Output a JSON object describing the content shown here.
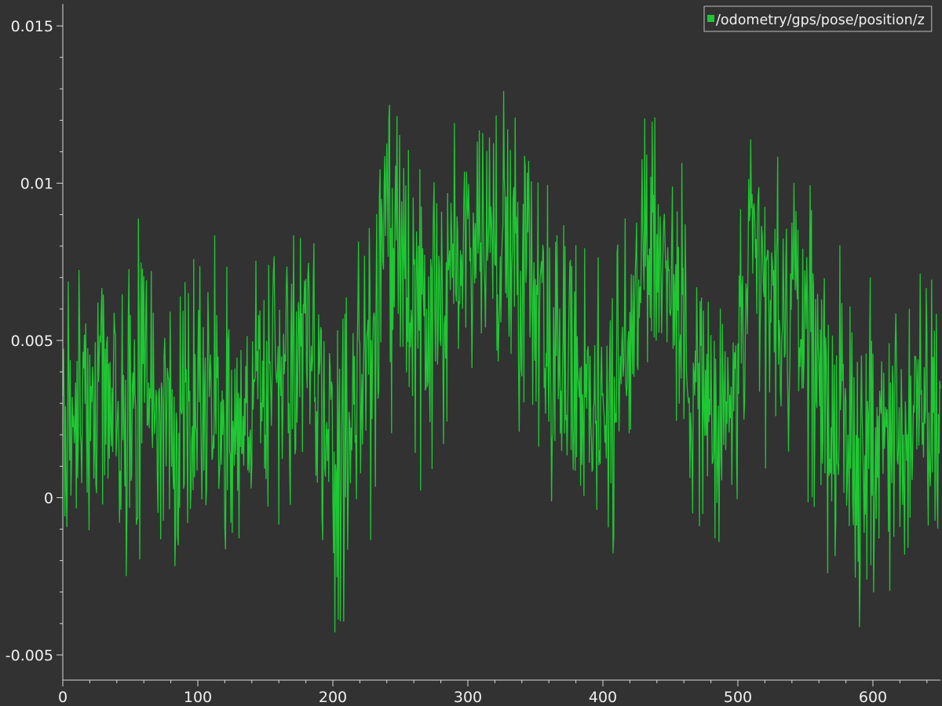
{
  "chart_data": {
    "type": "line",
    "title": "",
    "xlabel": "",
    "ylabel": "",
    "xlim": [
      0,
      650
    ],
    "ylim": [
      -0.0058,
      0.0157
    ],
    "x_ticks": [
      {
        "value": 0,
        "label": "0"
      },
      {
        "value": 100,
        "label": "100"
      },
      {
        "value": 200,
        "label": "200"
      },
      {
        "value": 300,
        "label": "300"
      },
      {
        "value": 400,
        "label": "400"
      },
      {
        "value": 500,
        "label": "500"
      },
      {
        "value": 600,
        "label": "600"
      }
    ],
    "y_ticks": [
      {
        "value": 0.015,
        "label": "0.015"
      },
      {
        "value": 0.01,
        "label": "0.01"
      },
      {
        "value": 0.005,
        "label": "0.005"
      },
      {
        "value": 0,
        "label": "0"
      },
      {
        "value": -0.005,
        "label": "-0.005"
      }
    ],
    "grid": false,
    "legend": {
      "position": "top-right"
    },
    "series": [
      {
        "name": "/odometry/gps/pose/position/z",
        "color": "#1ec832",
        "x": [
          0,
          10,
          20,
          30,
          40,
          50,
          60,
          70,
          80,
          90,
          100,
          110,
          120,
          130,
          140,
          150,
          160,
          170,
          180,
          190,
          200,
          210,
          220,
          230,
          240,
          250,
          260,
          270,
          280,
          290,
          300,
          310,
          320,
          330,
          340,
          350,
          360,
          370,
          380,
          390,
          400,
          410,
          420,
          430,
          440,
          450,
          460,
          470,
          480,
          490,
          500,
          510,
          520,
          530,
          540,
          550,
          560,
          570,
          580,
          590,
          600,
          610,
          620,
          630,
          640,
          650
        ],
        "y": [
          0.0025,
          0.003,
          0.0028,
          0.0032,
          0.003,
          0.0026,
          0.0034,
          0.003,
          0.0022,
          0.0024,
          0.0036,
          0.0032,
          0.0026,
          0.003,
          0.0028,
          0.0038,
          0.0042,
          0.004,
          0.0052,
          0.003,
          0.0006,
          0.001,
          0.004,
          0.0048,
          0.008,
          0.007,
          0.0058,
          0.005,
          0.006,
          0.0072,
          0.0085,
          0.0082,
          0.008,
          0.0082,
          0.008,
          0.0072,
          0.0055,
          0.004,
          0.0042,
          0.0035,
          0.003,
          0.0032,
          0.0045,
          0.009,
          0.008,
          0.007,
          0.005,
          0.004,
          0.002,
          0.002,
          0.004,
          0.007,
          0.0065,
          0.0055,
          0.0058,
          0.006,
          0.004,
          0.0025,
          0.0018,
          0.0012,
          0.0014,
          0.002,
          0.0022,
          0.002,
          0.0025,
          0.0028
        ]
      }
    ],
    "noise_amplitude": 0.0022
  }
}
